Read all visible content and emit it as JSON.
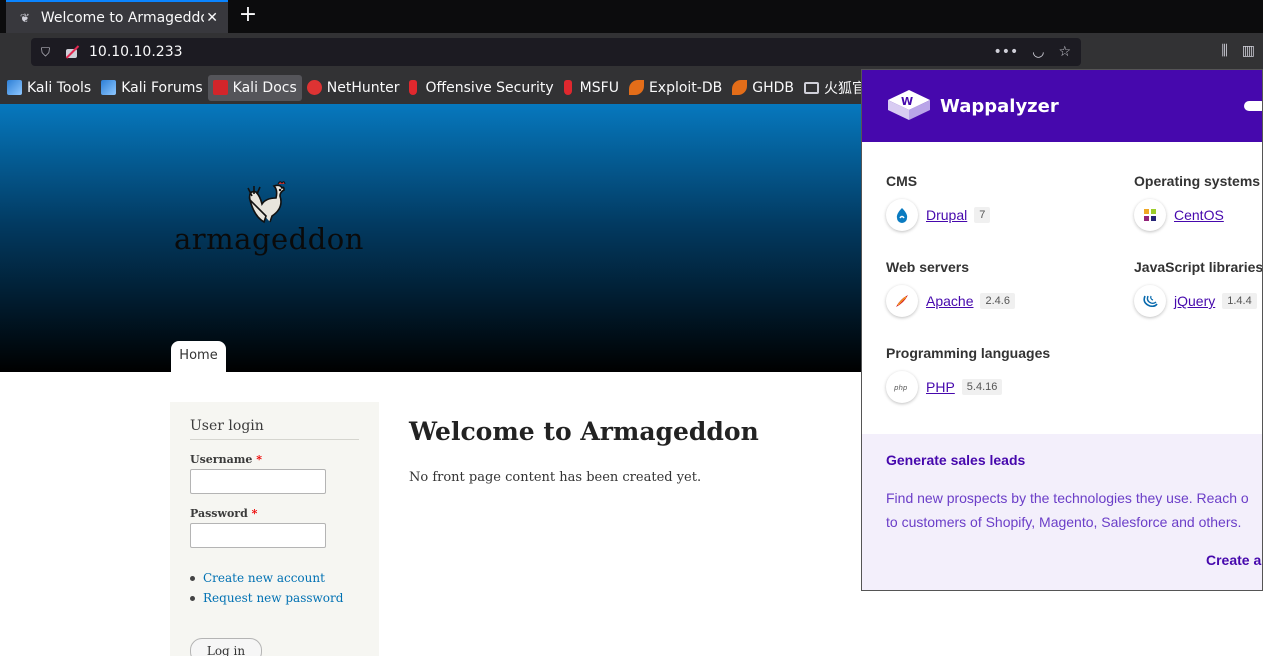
{
  "browser": {
    "tab_title": "Welcome to Armageddon",
    "tab_close": "✕",
    "new_tab": "+",
    "url": "10.10.10.233",
    "bookmarks": [
      {
        "label": "Kali Tools",
        "icon": "kali-dragon-icon"
      },
      {
        "label": "Kali Forums",
        "icon": "kali-dragon-icon"
      },
      {
        "label": "Kali Docs",
        "icon": "kali-docs-icon"
      },
      {
        "label": "NetHunter",
        "icon": "nethunter-icon"
      },
      {
        "label": "Offensive Security",
        "icon": "offsec-icon"
      },
      {
        "label": "MSFU",
        "icon": "offsec-icon"
      },
      {
        "label": "Exploit-DB",
        "icon": "exploitdb-icon"
      },
      {
        "label": "GHDB",
        "icon": "exploitdb-icon"
      },
      {
        "label": "火狐官",
        "icon": "folder-icon"
      }
    ]
  },
  "site": {
    "logo_text": "armageddon",
    "nav_home": "Home",
    "login": {
      "title": "User login",
      "username_label": "Username",
      "password_label": "Password",
      "required_mark": "*",
      "links": [
        "Create new account",
        "Request new password"
      ],
      "submit": "Log in"
    },
    "main": {
      "title": "Welcome to Armageddon",
      "text": "No front page content has been created yet."
    }
  },
  "wappalyzer": {
    "title": "Wappalyzer",
    "categories": {
      "cms": {
        "label": "CMS",
        "tech": {
          "name": "Drupal",
          "version": "7",
          "icon": "drupal-icon"
        }
      },
      "os": {
        "label": "Operating systems",
        "tech": {
          "name": "CentOS",
          "version": "",
          "icon": "centos-icon"
        }
      },
      "web_servers": {
        "label": "Web servers",
        "tech": {
          "name": "Apache",
          "version": "2.4.6",
          "icon": "apache-icon"
        }
      },
      "js_libraries": {
        "label": "JavaScript libraries",
        "tech": {
          "name": "jQuery",
          "version": "1.4.4",
          "icon": "jquery-icon"
        }
      },
      "languages": {
        "label": "Programming languages",
        "tech": {
          "name": "PHP",
          "version": "5.4.16",
          "icon": "php-icon"
        }
      }
    },
    "leads": {
      "title": "Generate sales leads",
      "line1": "Find new prospects by the technologies they use. Reach o",
      "line2": "to customers of Shopify, Magento, Salesforce and others.",
      "cta": "Create a"
    }
  },
  "colors": {
    "wappalyzer_purple": "#4608ad",
    "link_blue": "#0071b3",
    "header_top": "#0678be"
  }
}
